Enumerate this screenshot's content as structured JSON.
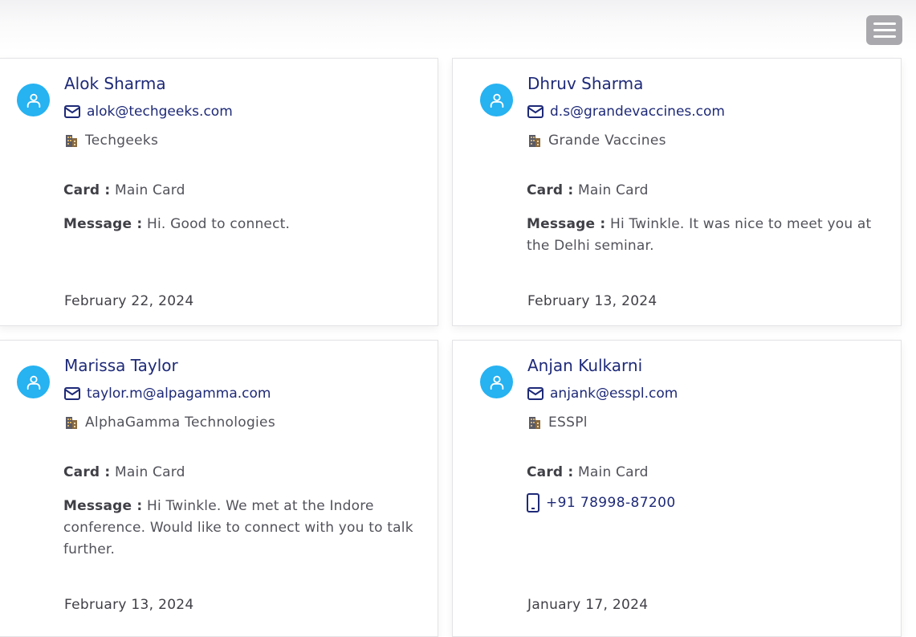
{
  "header": {
    "menu_icon": "hamburger-menu-icon"
  },
  "labels": {
    "card": "Card :",
    "message": "Message :"
  },
  "colors": {
    "avatar": "#27b2f1",
    "name": "#1e2a78",
    "menu_button": "#a9a9ad"
  },
  "contacts": [
    {
      "name": "Alok Sharma",
      "email": "alok@techgeeks.com",
      "company": "Techgeeks",
      "card": "Main Card",
      "message": "Hi. Good to connect.",
      "date": "February 22, 2024"
    },
    {
      "name": "Dhruv Sharma",
      "email": "d.s@grandevaccines.com",
      "company": "Grande Vaccines",
      "card": "Main Card",
      "message": "Hi Twinkle. It was nice to meet you at the Delhi seminar.",
      "date": "February 13, 2024"
    },
    {
      "name": "Marissa Taylor",
      "email": "taylor.m@alpagamma.com",
      "company": "AlphaGamma Technologies",
      "card": "Main Card",
      "message": "Hi Twinkle. We met at the Indore conference. Would like to connect with you to talk further.",
      "date": "February 13, 2024"
    },
    {
      "name": "Anjan Kulkarni",
      "email": "anjank@esspl.com",
      "company": "ESSPl",
      "card": "Main Card",
      "phone": "+91 78998-87200",
      "date": "January 17, 2024"
    }
  ]
}
